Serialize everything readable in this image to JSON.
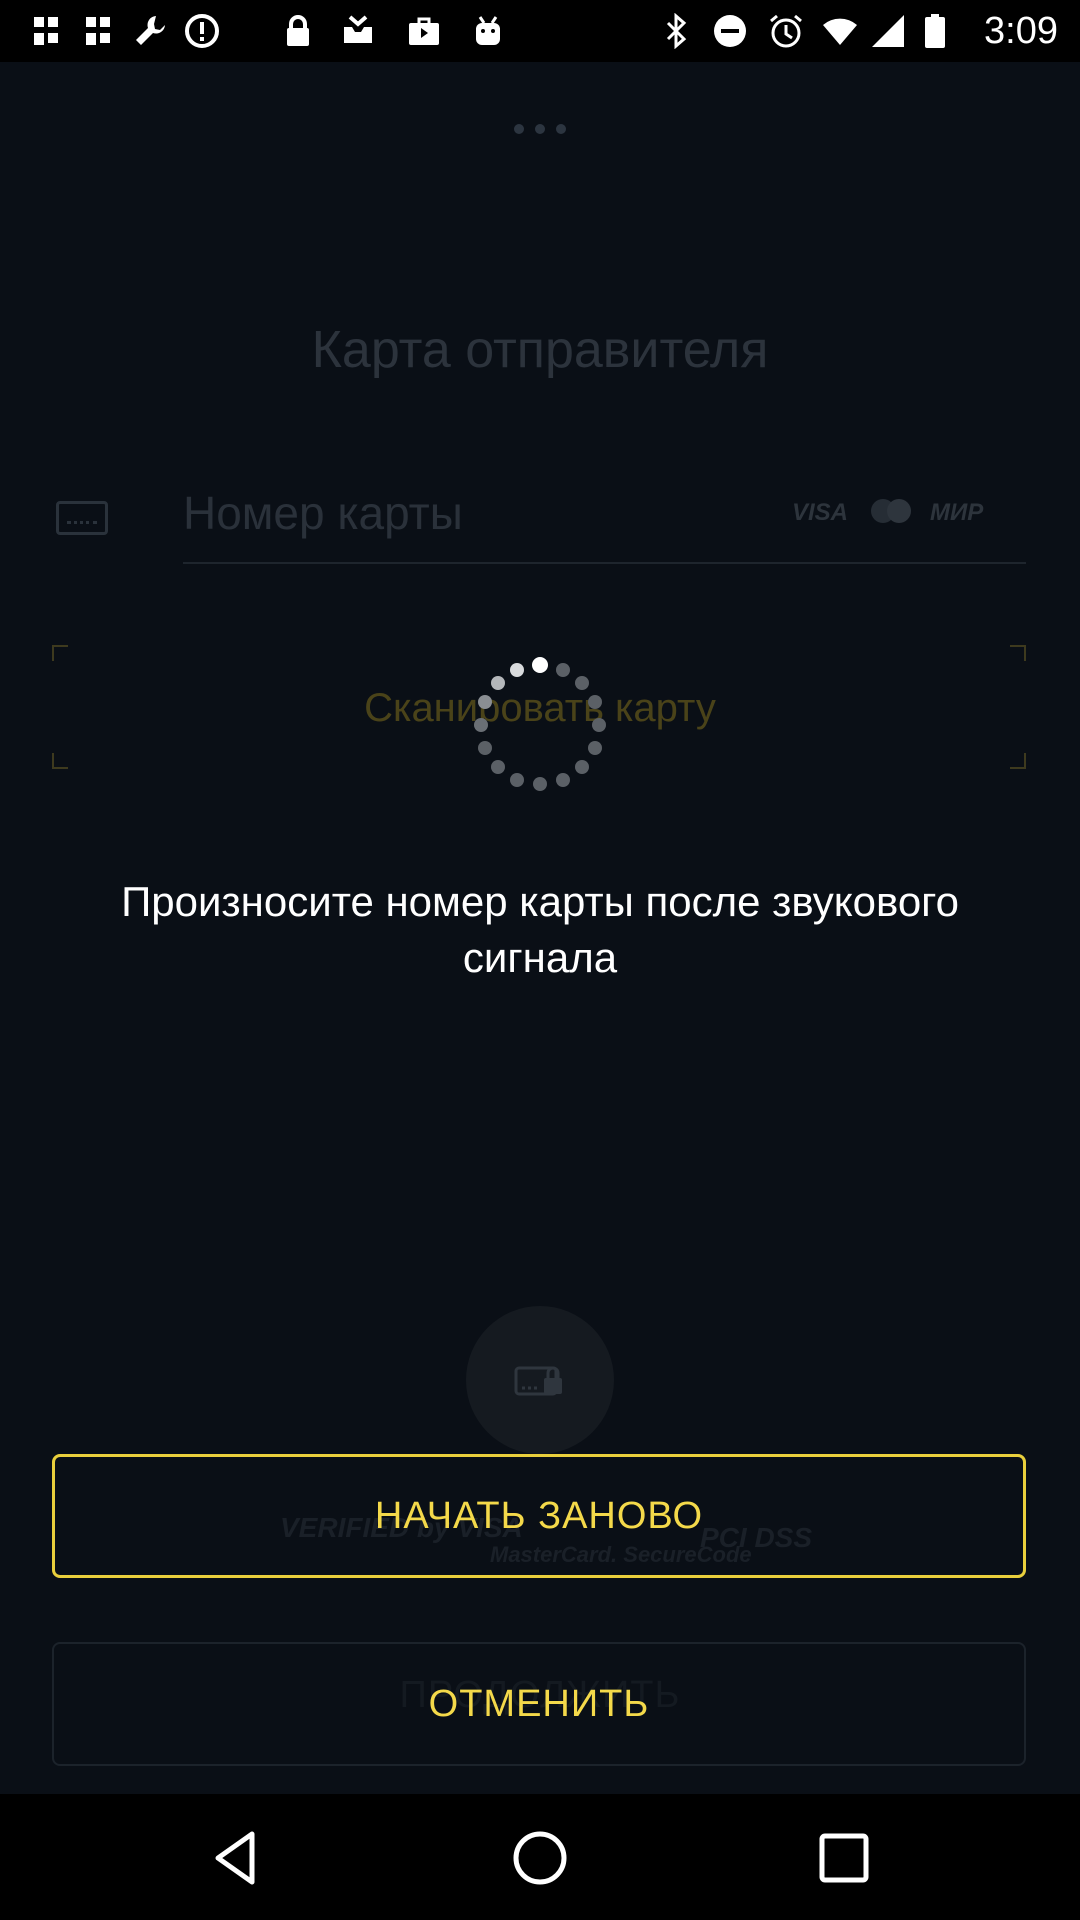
{
  "status_bar": {
    "time": "3:09",
    "icons": [
      "slack-icon",
      "slack-icon",
      "wrench-icon",
      "alert-icon",
      "lock-icon",
      "inbox-icon",
      "briefcase-icon",
      "android-icon",
      "bluetooth-icon",
      "dnd-icon",
      "alarm-icon",
      "wifi-icon",
      "signal-icon",
      "battery-icon"
    ]
  },
  "screen": {
    "menu_icon": "more-dots-icon",
    "title": "Карта отправителя",
    "card_number_placeholder": "Номер карты",
    "card_brands": [
      "VISA",
      "МИР"
    ],
    "scan_label": "Сканировать карту",
    "instruction": "Произносите номер карты после звукового сигнала",
    "security_badges": [
      "VERIFIED by VISA",
      "MasterCard. SecureCode",
      "PCI DSS"
    ],
    "restart_button": "НАЧАТЬ ЗАНОВО",
    "cancel_button": "ОТМЕНИТЬ",
    "continue_button_ghost": "ПРОДОЛЖИТЬ"
  },
  "colors": {
    "background": "#0a0f16",
    "accent": "#f4d94a",
    "text": "#ffffff"
  },
  "nav_bar": {
    "buttons": [
      "back-icon",
      "home-icon",
      "recents-icon"
    ]
  }
}
